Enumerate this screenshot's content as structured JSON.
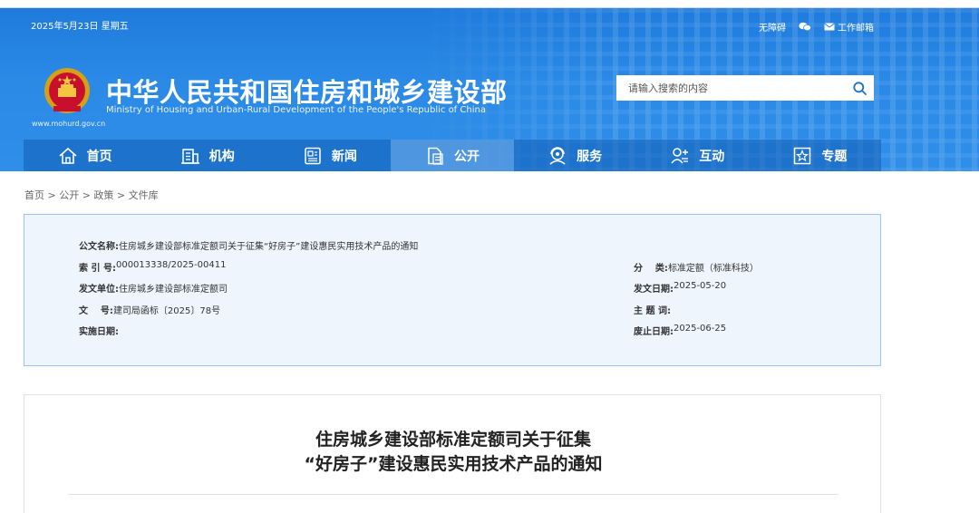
{
  "header": {
    "date": "2025年5月23日 星期五",
    "top_links": {
      "accessibility": "无障碍",
      "work_mail": "工作邮箱"
    },
    "site_title": "中华人民共和国住房和城乡建设部",
    "site_subtitle": "Ministry of Housing and Urban-Rural Development of the People's Republic of China",
    "site_domain": "www.mohurd.gov.cn",
    "search_placeholder": "请输入搜索的内容"
  },
  "nav": {
    "items": [
      {
        "label": "首页",
        "icon": "home-icon"
      },
      {
        "label": "机构",
        "icon": "building-icon"
      },
      {
        "label": "新闻",
        "icon": "newspaper-icon"
      },
      {
        "label": "公开",
        "icon": "document-icon",
        "active": true
      },
      {
        "label": "服务",
        "icon": "service-icon"
      },
      {
        "label": "互动",
        "icon": "user-interaction-icon"
      },
      {
        "label": "专题",
        "icon": "star-icon"
      }
    ]
  },
  "breadcrumb": "首页 > 公开 > 政策 > 文件库",
  "info": {
    "title_label": "公文名称:",
    "title_value": "住房城乡建设部标准定额司关于征集“好房子”建设惠民实用技术产品的通知",
    "index_label": "索 引 号:",
    "index_value": "000013338/2025-00411",
    "category_label": "分    类:",
    "category_value": "标准定额（标准科技）",
    "issuer_label": "发文单位:",
    "issuer_value": "住房城乡建设部标准定额司",
    "issue_date_label": "发文日期:",
    "issue_date_value": "2025-05-20",
    "doc_no_label": "文    号:",
    "doc_no_value": "建司局函标〔2025〕78号",
    "keywords_label": "主 题 词:",
    "keywords_value": "",
    "effective_label": "实施日期:",
    "effective_value": "",
    "expiry_label": "废止日期:",
    "expiry_value": "2025-06-25"
  },
  "article": {
    "title_line1": "住房城乡建设部标准定额司关于征集",
    "title_line2": "“好房子”建设惠民实用技术产品的通知"
  },
  "colors": {
    "header_blue": "#2a8ae6",
    "nav_active": "#7ab4f0",
    "info_bg": "#eef5fd",
    "info_border": "#9fc6ee"
  }
}
